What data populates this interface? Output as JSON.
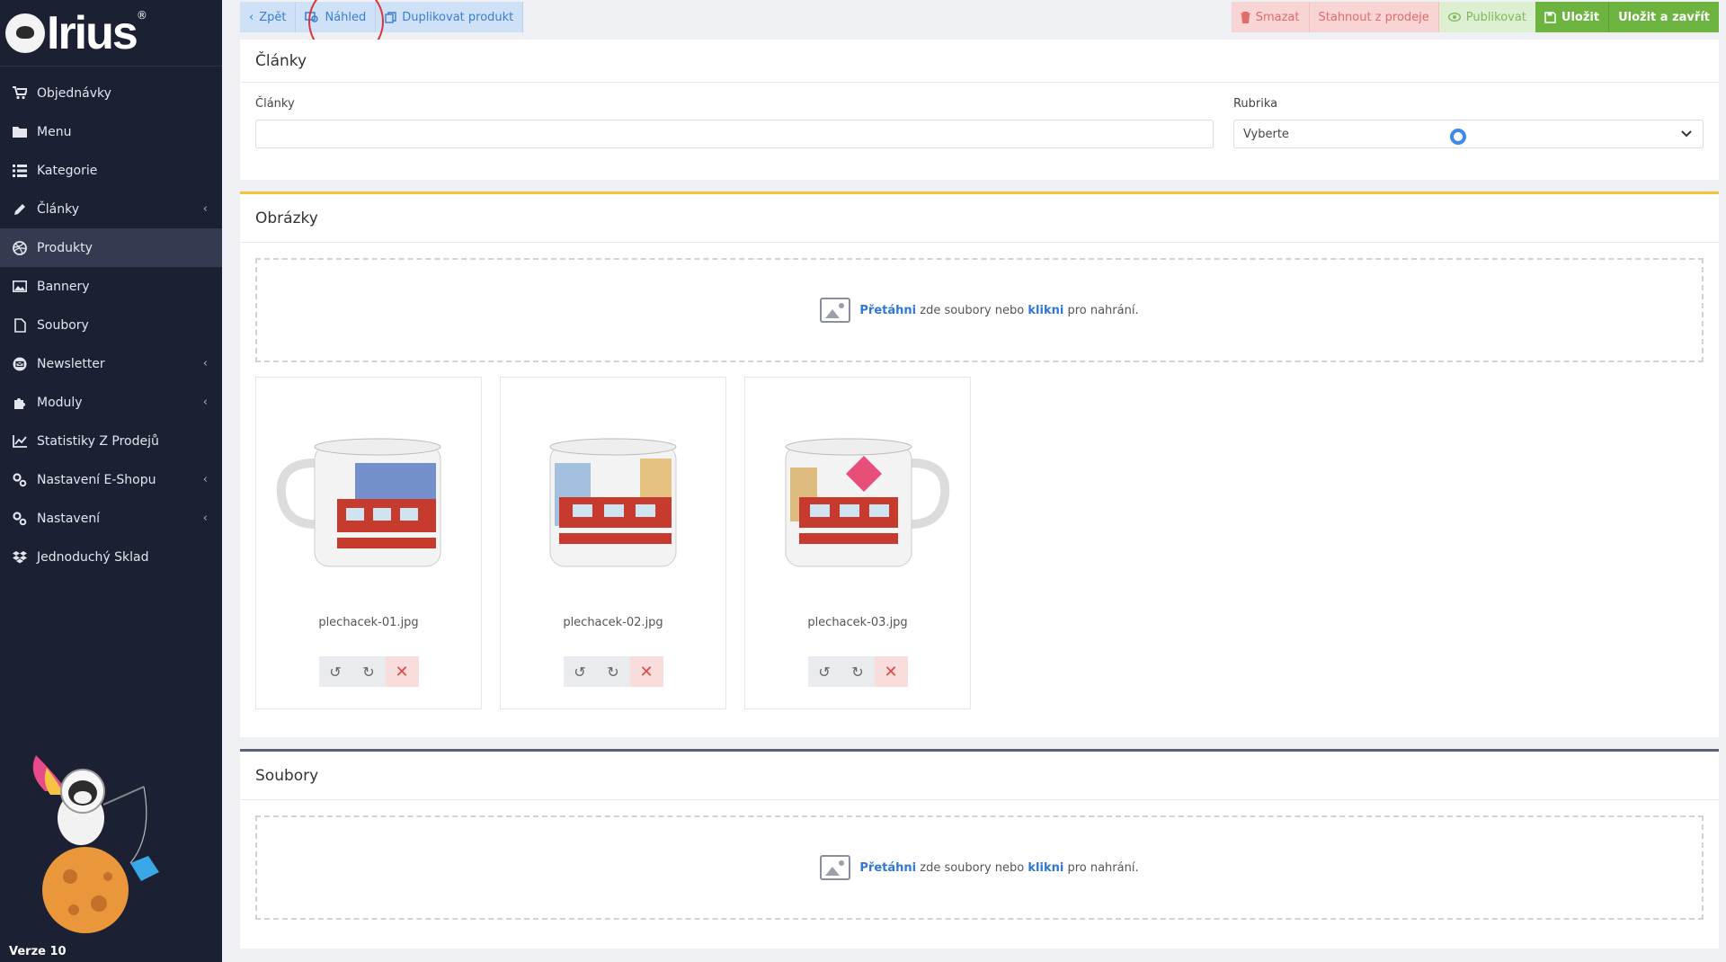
{
  "sidebar": {
    "logo_text": "Irius",
    "logo_reg": "®",
    "items": [
      {
        "label": "Objednávky",
        "icon": "cart-icon",
        "has_children": false,
        "active": false
      },
      {
        "label": "Menu",
        "icon": "folder-icon",
        "has_children": false,
        "active": false
      },
      {
        "label": "Kategorie",
        "icon": "list-icon",
        "has_children": false,
        "active": false
      },
      {
        "label": "Články",
        "icon": "pencil-icon",
        "has_children": true,
        "active": false
      },
      {
        "label": "Produkty",
        "icon": "dribbble-icon",
        "has_children": false,
        "active": true
      },
      {
        "label": "Bannery",
        "icon": "image-icon",
        "has_children": false,
        "active": false
      },
      {
        "label": "Soubory",
        "icon": "file-icon",
        "has_children": false,
        "active": false
      },
      {
        "label": "Newsletter",
        "icon": "envelope-icon",
        "has_children": true,
        "active": false
      },
      {
        "label": "Moduly",
        "icon": "puzzle-icon",
        "has_children": true,
        "active": false
      },
      {
        "label": "Statistiky Z Prodejů",
        "icon": "chart-icon",
        "has_children": false,
        "active": false
      },
      {
        "label": "Nastavení E-Shopu",
        "icon": "cogs-icon",
        "has_children": true,
        "active": false
      },
      {
        "label": "Nastavení",
        "icon": "cogs-icon",
        "has_children": true,
        "active": false
      },
      {
        "label": "Jednoduchý Sklad",
        "icon": "dropbox-icon",
        "has_children": false,
        "active": false
      }
    ],
    "version": "Verze 10"
  },
  "toolbar": {
    "back": "Zpět",
    "preview": "Náhled",
    "duplicate": "Duplikovat produkt",
    "delete": "Smazat",
    "withdraw": "Stahnout z prodeje",
    "publish": "Publikovat",
    "save": "Uložit",
    "save_close": "Uložit a zavřít"
  },
  "articles_panel": {
    "title": "Články",
    "field_label": "Články",
    "field_value": "",
    "rubric_label": "Rubrika",
    "rubric_value": "Vyberte"
  },
  "images_panel": {
    "title": "Obrázky",
    "drop_link1": "Přetáhni",
    "drop_mid": "zde soubory nebo",
    "drop_link2": "klikni",
    "drop_end": "pro nahrání.",
    "images": [
      {
        "filename": "plechacek-01.jpg"
      },
      {
        "filename": "plechacek-02.jpg"
      },
      {
        "filename": "plechacek-03.jpg"
      }
    ]
  },
  "files_panel": {
    "title": "Soubory",
    "drop_link1": "Přetáhni",
    "drop_mid": "zde soubory nebo",
    "drop_link2": "klikni",
    "drop_end": "pro nahrání."
  },
  "colors": {
    "sidebar_bg": "#1b2033",
    "accent_blue": "#2f78d6",
    "save_green": "#6db33f",
    "images_border": "#f2c334",
    "delete_red": "#e04848"
  }
}
